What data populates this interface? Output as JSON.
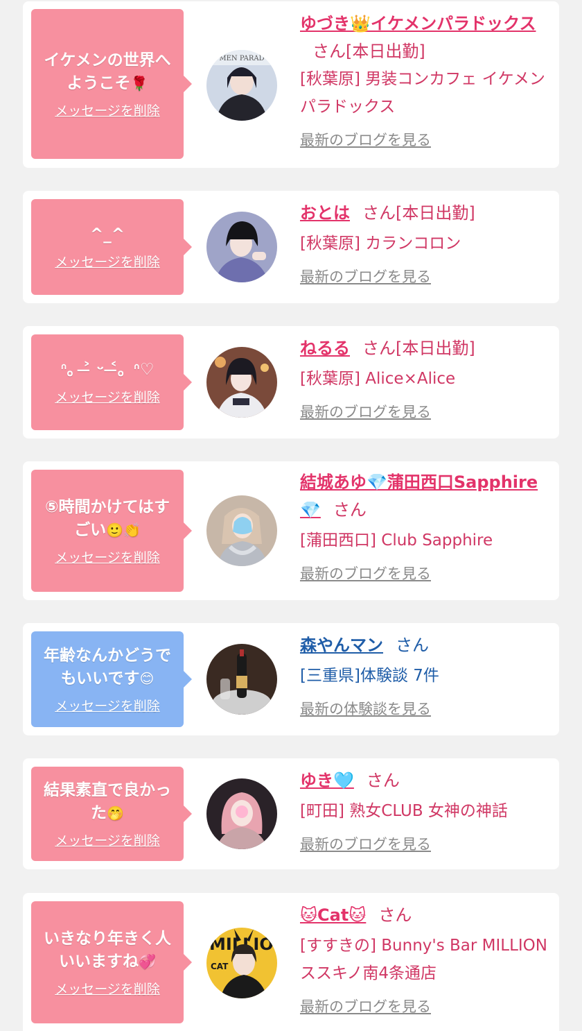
{
  "messages": [
    {
      "bubble_text": "イケメンの世界へようこそ",
      "bubble_emoji": "🌹",
      "delete_label": "メッセージを削除",
      "name": "ゆづき👑イケメンパラドックス",
      "honorific": "さん[本日出勤]",
      "shop": "[秋葉原] 男装コンカフェ イケメンパラドックス",
      "more_label": "最新のブログを見る"
    },
    {
      "bubble_text": "^_^",
      "bubble_emoji": "",
      "delete_label": "メッセージを削除",
      "name": "おとは",
      "honorific": "さん[本日出勤]",
      "shop": "[秋葉原] カランコロン",
      "more_label": "最新のブログを見る"
    },
    {
      "bubble_text": "ᐢ。˃̶ ᵕ ˂̶。ᐢ♡",
      "bubble_emoji": "",
      "delete_label": "メッセージを削除",
      "name": "ねるる",
      "honorific": "さん[本日出勤]",
      "shop": "[秋葉原] Alice×Alice",
      "more_label": "最新のブログを見る"
    },
    {
      "bubble_text": "⑤時間かけてはすごい",
      "bubble_emoji": "🙂👏",
      "delete_label": "メッセージを削除",
      "name": "結城あゆ💎蒲田西口Sapphire💎",
      "honorific": "さん",
      "shop": "[蒲田西口] Club Sapphire",
      "more_label": "最新のブログを見る"
    },
    {
      "bubble_text": "年齢なんかどうでもいいです",
      "bubble_emoji": "😊",
      "delete_label": "メッセージを削除",
      "name": "森やんマン",
      "honorific": "さん",
      "shop": "[三重県]体験談 7件",
      "more_label": "最新の体験談を見る"
    },
    {
      "bubble_text": "結果素直で良かった",
      "bubble_emoji": "🤭",
      "delete_label": "メッセージを削除",
      "name": "ゆき🩵",
      "honorific": "さん",
      "shop": "[町田] 熟女CLUB 女神の神話",
      "more_label": "最新のブログを見る"
    },
    {
      "bubble_text": "いきなり年きく人いいますね",
      "bubble_emoji": "💞",
      "delete_label": "メッセージを削除",
      "name": "🐱Cat🐱",
      "honorific": "さん",
      "shop": "[すすきの] Bunny's Bar MILLION ススキノ南4条通店",
      "more_label": "最新のブログを見る"
    }
  ],
  "colors": {
    "pink_bubble": "#f7909f",
    "blue_bubble": "#88b4f3",
    "pink_text": "#e3336a",
    "blue_text": "#1f5da8",
    "link_gray": "#8a8a8a",
    "background": "#f1f1f1"
  }
}
